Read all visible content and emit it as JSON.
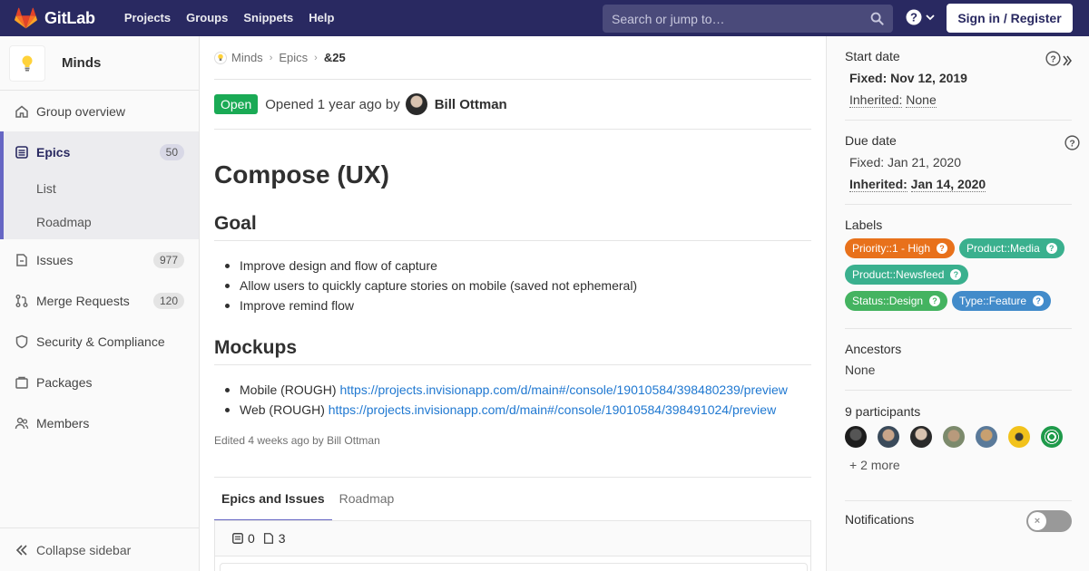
{
  "navbar": {
    "brand": "GitLab",
    "links": [
      "Projects",
      "Groups",
      "Snippets",
      "Help"
    ],
    "search_placeholder": "Search or jump to…",
    "signin_label": "Sign in / Register"
  },
  "sidebar": {
    "group_name": "Minds",
    "items": [
      {
        "label": "Group overview",
        "icon": "home-icon"
      },
      {
        "label": "Epics",
        "count": "50",
        "icon": "epic-icon",
        "active": true,
        "sub": [
          "List",
          "Roadmap"
        ]
      },
      {
        "label": "Issues",
        "count": "977",
        "icon": "issues-icon"
      },
      {
        "label": "Merge Requests",
        "count": "120",
        "icon": "merge-request-icon"
      },
      {
        "label": "Security & Compliance",
        "icon": "shield-icon"
      },
      {
        "label": "Packages",
        "icon": "package-icon"
      },
      {
        "label": "Members",
        "icon": "users-icon"
      }
    ],
    "collapse_label": "Collapse sidebar"
  },
  "breadcrumb": {
    "group": "Minds",
    "section": "Epics",
    "current": "&25"
  },
  "epic": {
    "status": "Open",
    "opened_text": "Opened 1 year ago by",
    "author": "Bill Ottman",
    "title": "Compose (UX)",
    "goal_heading": "Goal",
    "goal_items": [
      "Improve design and flow of capture",
      "Allow users to quickly capture stories on mobile (saved not ephemeral)",
      "Improve remind flow"
    ],
    "mockups_heading": "Mockups",
    "mockups": [
      {
        "prefix": "Mobile (ROUGH)",
        "url": "https://projects.invisionapp.com/d/main#/console/19010584/398480239/preview"
      },
      {
        "prefix": "Web (ROUGH)",
        "url": "https://projects.invisionapp.com/d/main#/console/19010584/398491024/preview"
      }
    ],
    "edited_text": "Edited 4 weeks ago by Bill Ottman"
  },
  "tabs": {
    "epics_and_issues": "Epics and Issues",
    "roadmap": "Roadmap"
  },
  "tree": {
    "epic_count": "0",
    "issue_count": "3"
  },
  "right_sidebar": {
    "start_date": {
      "title": "Start date",
      "fixed_label": "Fixed:",
      "fixed_value": "Nov 12, 2019",
      "inherited_label": "Inherited:",
      "inherited_value": "None"
    },
    "due_date": {
      "title": "Due date",
      "fixed_label": "Fixed:",
      "fixed_value": "Jan 21, 2020",
      "inherited_label": "Inherited:",
      "inherited_value": "Jan 14, 2020"
    },
    "labels": {
      "title": "Labels",
      "items": [
        {
          "text": "Priority::1 - High",
          "color": "#e8711b"
        },
        {
          "text": "Product::Media",
          "color": "#3ab08e"
        },
        {
          "text": "Product::Newsfeed",
          "color": "#3ab08e"
        },
        {
          "text": "Status::Design",
          "color": "#44b360"
        },
        {
          "text": "Type::Feature",
          "color": "#428bca"
        }
      ]
    },
    "ancestors": {
      "title": "Ancestors",
      "value": "None"
    },
    "participants": {
      "title": "9 participants",
      "more": "+ 2 more"
    },
    "notifications": {
      "title": "Notifications"
    }
  },
  "colors": {
    "navbar": "#292961",
    "accent": "#6666c4",
    "open_badge": "#1aaa55",
    "link": "#1f78d1"
  }
}
